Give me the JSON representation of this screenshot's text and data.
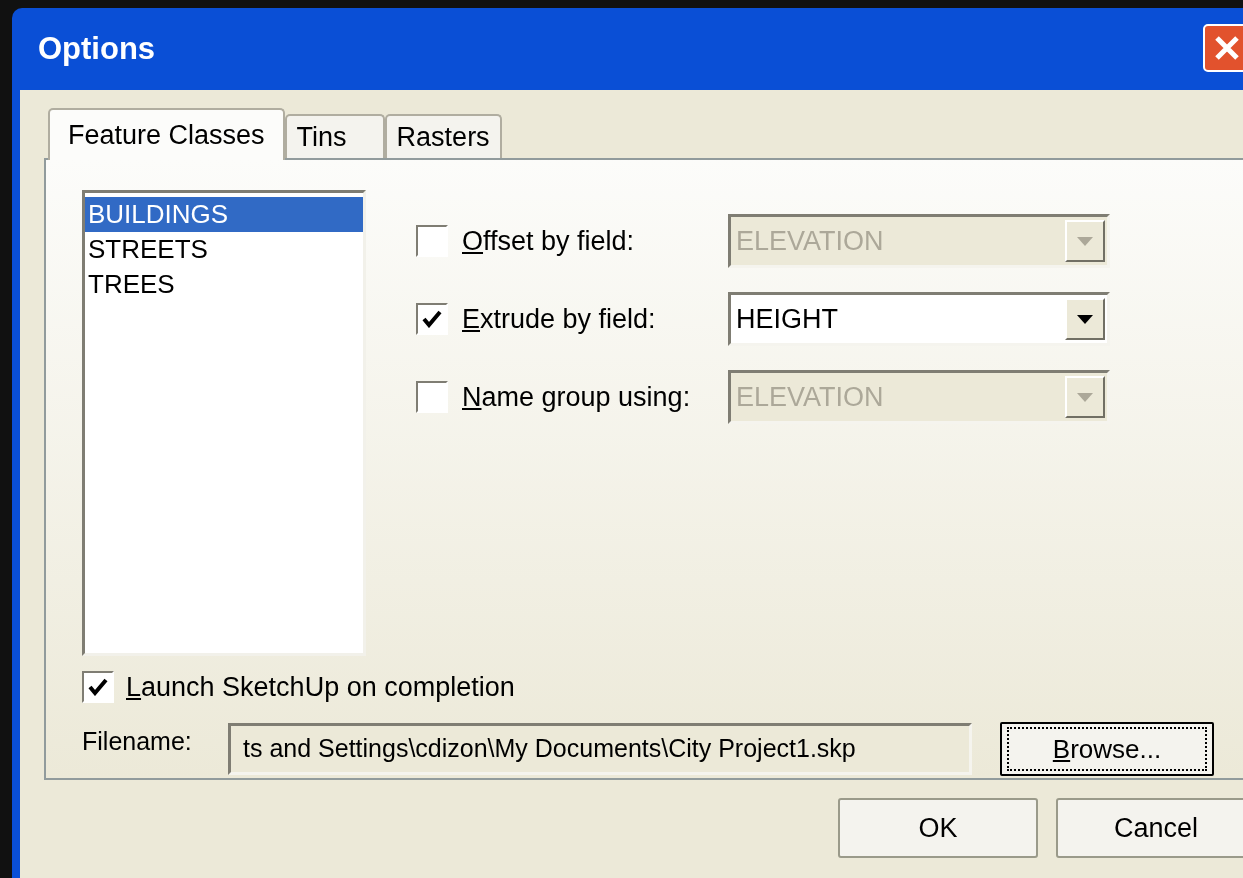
{
  "window": {
    "title": "Options"
  },
  "tabs": [
    {
      "label": "Feature Classes",
      "selected": true
    },
    {
      "label": "Tins",
      "selected": false
    },
    {
      "label": "Rasters",
      "selected": false
    }
  ],
  "layers": [
    {
      "label": "BUILDINGS",
      "selected": true
    },
    {
      "label": "STREETS",
      "selected": false
    },
    {
      "label": "TREES",
      "selected": false
    }
  ],
  "options": [
    {
      "label": "Offset by field:",
      "mnemonic": true,
      "checked": false,
      "value": "ELEVATION",
      "disabled": true
    },
    {
      "label": "Extrude by field:",
      "mnemonic": true,
      "checked": true,
      "value": "HEIGHT",
      "disabled": false
    },
    {
      "label": "Name group using:",
      "mnemonic": true,
      "checked": false,
      "value": "ELEVATION",
      "disabled": true
    }
  ],
  "launch": {
    "label": "Launch SketchUp on completion",
    "mnemonic": true,
    "checked": true
  },
  "filename": {
    "label": "Filename:",
    "value": "ts and Settings\\cdizon\\My Documents\\City Project1.skp"
  },
  "browse": {
    "label": "Browse...",
    "mnemonic": true,
    "focused": true
  },
  "buttons": [
    {
      "label": "OK"
    },
    {
      "label": "Cancel"
    }
  ]
}
